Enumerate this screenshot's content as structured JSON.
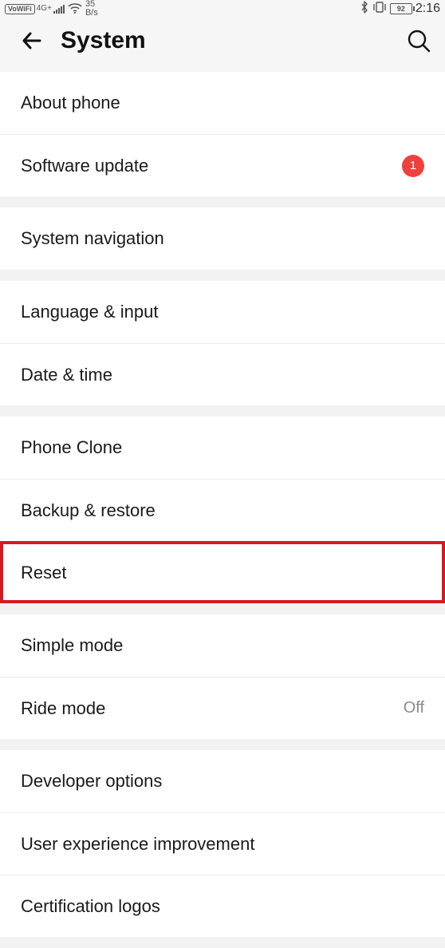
{
  "status": {
    "vowifi": "VoWiFi",
    "net_gen": "4G+",
    "speed_top": "35",
    "speed_bottom": "B/s",
    "battery": "92",
    "time": "2:16"
  },
  "header": {
    "title": "System"
  },
  "groups": [
    {
      "items": [
        {
          "label": "About phone"
        },
        {
          "label": "Software update",
          "badge": "1"
        }
      ]
    },
    {
      "items": [
        {
          "label": "System navigation"
        }
      ]
    },
    {
      "items": [
        {
          "label": "Language & input"
        },
        {
          "label": "Date & time"
        }
      ]
    },
    {
      "items": [
        {
          "label": "Phone Clone"
        },
        {
          "label": "Backup & restore"
        },
        {
          "label": "Reset",
          "highlight": true
        }
      ]
    },
    {
      "items": [
        {
          "label": "Simple mode"
        },
        {
          "label": "Ride mode",
          "value": "Off"
        }
      ]
    },
    {
      "items": [
        {
          "label": "Developer options"
        },
        {
          "label": "User experience improvement"
        },
        {
          "label": "Certification logos"
        }
      ]
    }
  ]
}
